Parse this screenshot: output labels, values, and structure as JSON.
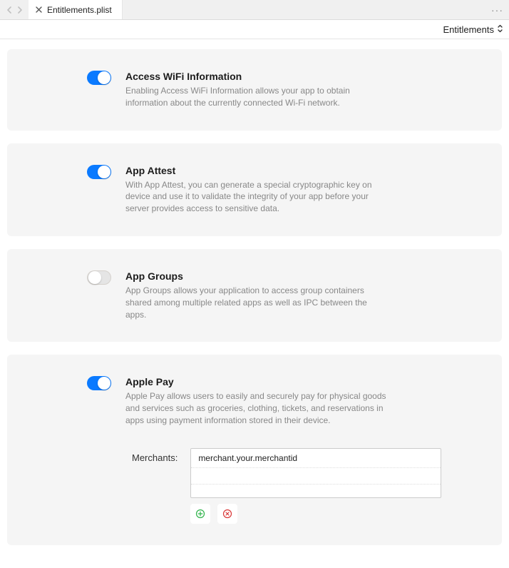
{
  "toolbar": {
    "tab_title": "Entitlements.plist",
    "view_mode": "Entitlements"
  },
  "cards": {
    "wifi": {
      "title": "Access WiFi Information",
      "desc": "Enabling Access WiFi Information allows your app to obtain information about the currently connected Wi-Fi network."
    },
    "attest": {
      "title": "App Attest",
      "desc": "With App Attest, you can generate a special cryptographic key on device and use it to validate the integrity of your app before your server provides access to sensitive data."
    },
    "groups": {
      "title": "App Groups",
      "desc": "App Groups allows your application to access group containers shared among multiple related apps as well as IPC between the apps."
    },
    "applepay": {
      "title": "Apple Pay",
      "desc": "Apple Pay allows users to easily and securely pay for physical goods and services such as groceries, clothing, tickets, and reservations in apps using payment information stored in their device.",
      "merchants_label": "Merchants:",
      "merchants": [
        "merchant.your.merchantid"
      ]
    }
  }
}
